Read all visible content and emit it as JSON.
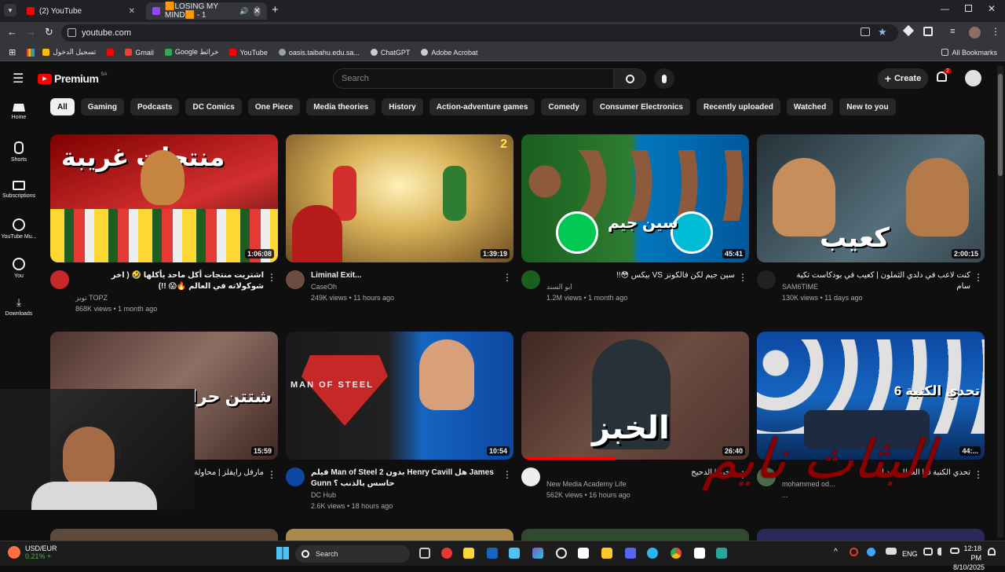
{
  "browser": {
    "tabs": [
      {
        "label": "(2) YouTube",
        "active": false
      },
      {
        "label": "🟧LOSING MY MIND🟧 - 1",
        "active": true
      }
    ],
    "new_tab": "+",
    "url": "youtube.com",
    "bookmarks": [
      "تسجيل الدخول",
      "Gmail",
      "Google خرائط",
      "YouTube",
      "oasis.taibahu.edu.sa...",
      "ChatGPT",
      "Adobe Acrobat"
    ],
    "all_bookmarks": "All Bookmarks"
  },
  "youtube": {
    "logo": "Premium",
    "region": "SA",
    "search_placeholder": "Search",
    "create_label": "Create",
    "notif_count": "2",
    "guide": [
      "Home",
      "Shorts",
      "Subscriptions",
      "YouTube Mu...",
      "You",
      "Downloads"
    ],
    "chips": [
      "All",
      "Gaming",
      "Podcasts",
      "DC Comics",
      "One Piece",
      "Media theories",
      "History",
      "Action-adventure games",
      "Comedy",
      "Consumer Electronics",
      "Recently uploaded",
      "Watched",
      "New to you"
    ],
    "videos": [
      {
        "title": "اشتريت منتجات أكل ماحد يأكلها 🤣 ( اخر شوكولاته في العالم 🔥😱 !!)",
        "channel": "توبز TOPZ",
        "stats": "868K views • 1 month ago",
        "duration": "1:06:08",
        "thumb_text": "منتجات غريبة",
        "thumb_color": "#b71c1c"
      },
      {
        "title": "Liminal Exit...",
        "channel": "CaseOh",
        "stats": "249K views • 11 hours ago",
        "duration": "1:39:19",
        "thumb_text": "2",
        "thumb_color": "#c8a24a"
      },
      {
        "title": "سين جيم لكن فالكونز VS بيكس 😳!!",
        "channel": "ابو السند",
        "stats": "1.2M views • 1 month ago",
        "duration": "45:41",
        "thumb_text": "سين جيم",
        "thumb_color": "#2e7d32"
      },
      {
        "title": "كنت لاعب في دلدي الثملون | كعيب في بودكاست تكية سام",
        "channel": "SAM6TIME",
        "stats": "130K views • 11 days ago",
        "duration": "2:00:15",
        "thumb_text": "كعيب",
        "thumb_color": "#3e4a5a"
      },
      {
        "title": "مارفل رايفلز | محاولة",
        "channel": "",
        "stats": "",
        "duration": "15:59",
        "thumb_text": "شتتن حرااا",
        "thumb_color": "#5d4037"
      },
      {
        "title": "فيلم Man of Steel 2 بدون Henry Cavill هل James Gunn حاسس بالذنب ؟",
        "channel": "DC Hub",
        "stats": "2.6K views • 18 hours ago",
        "duration": "10:54",
        "thumb_text": "MAN OF STEEL",
        "thumb_color": "#1a237e"
      },
      {
        "title": "الخبز | الدحيح",
        "channel": "New Media Academy Life",
        "stats": "562K views • 16 hours ago",
        "duration": "26:40",
        "thumb_text": "الخبز",
        "thumb_color": "#3e2723"
      },
      {
        "title": "تحدي الكنبة 6 | العطل ضد الـ...",
        "channel": "mohammed od...",
        "stats": "...",
        "duration": "44:...",
        "thumb_text": "تحدي الكنبة 6",
        "thumb_color": "#0d47a1"
      }
    ]
  },
  "overlay_text": "البثاث نايم",
  "taskbar": {
    "ticker": "USD/EUR",
    "ticker_change": "0.21% +",
    "search": "Search",
    "lang": "ENG",
    "time": "12:18 PM",
    "date": "8/10/2025"
  }
}
